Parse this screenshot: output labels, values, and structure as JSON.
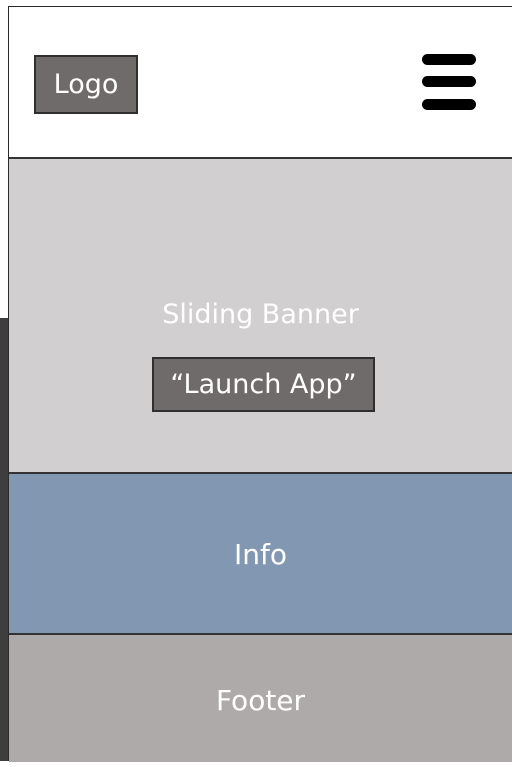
{
  "header": {
    "logo_label": "Logo",
    "menu_icon": "hamburger-menu-icon"
  },
  "banner": {
    "title": "Sliding Banner",
    "button_label": "“Launch App”"
  },
  "info": {
    "label": "Info"
  },
  "footer": {
    "label": "Footer"
  },
  "colors": {
    "header_bg": "#ffffff",
    "logo_bg": "#6f6b6b",
    "banner_bg": "#d1cfd0",
    "info_bg": "#8298b2",
    "footer_bg": "#aeaaa9",
    "text": "#ffffff",
    "border": "#333333"
  }
}
